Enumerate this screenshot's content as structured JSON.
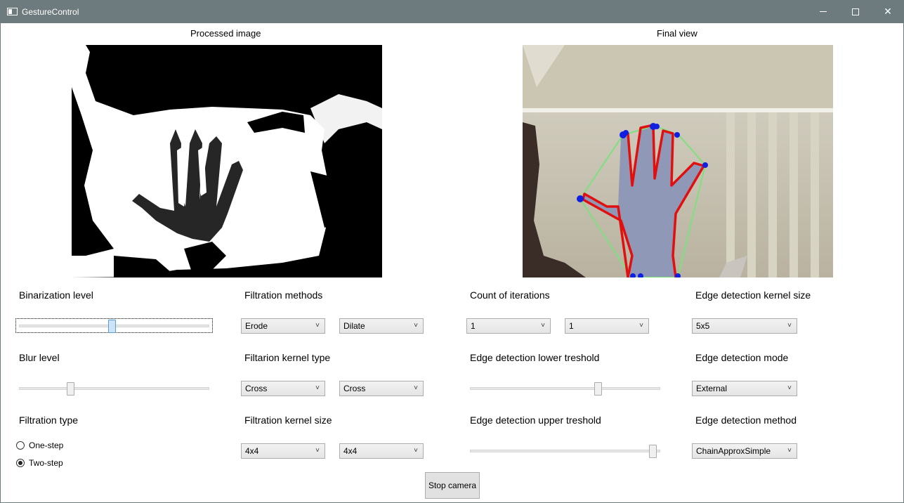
{
  "window": {
    "title": "GestureControl",
    "icons": {
      "app": "app-window-icon",
      "minimize": "minimize-icon",
      "maximize": "maximize-icon",
      "close": "close-icon"
    },
    "close_glyph": "✕"
  },
  "views": {
    "processed_caption": "Processed image",
    "final_caption": "Final view"
  },
  "controls": {
    "binarization": {
      "label": "Binarization level",
      "value_fraction": 0.49
    },
    "blur": {
      "label": "Blur level",
      "value_fraction": 0.26
    },
    "filtration_type": {
      "label": "Filtration type",
      "options": [
        "One-step",
        "Two-step"
      ],
      "selected": "Two-step"
    },
    "filtration_methods": {
      "label": "Filtration methods",
      "first": "Erode",
      "second": "Dilate"
    },
    "filtration_kernel_type": {
      "label": "Filtarion kernel type",
      "first": "Cross",
      "second": "Cross"
    },
    "filtration_kernel_size": {
      "label": "Filtration kernel size",
      "first": "4x4",
      "second": "4x4"
    },
    "count_of_iterations": {
      "label": "Count of iterations",
      "first": "1",
      "second": "1"
    },
    "edge_lower": {
      "label": "Edge detection lower treshold",
      "value_fraction": 0.68
    },
    "edge_upper": {
      "label": "Edge detection upper treshold",
      "value_fraction": 0.98
    },
    "edge_kernel_size": {
      "label": "Edge detection kernel size",
      "value": "5x5"
    },
    "edge_mode": {
      "label": "Edge detection mode",
      "value": "External"
    },
    "edge_method": {
      "label": "Edge detection method",
      "value": "ChainApproxSimple"
    },
    "dropdown_glyph": "˅"
  },
  "actions": {
    "stop_camera": "Stop camera"
  },
  "colors": {
    "titlebar": "#6e7b7e",
    "contour": "#e01010",
    "hull": "#7ee07e",
    "defects": "#1020e0"
  }
}
